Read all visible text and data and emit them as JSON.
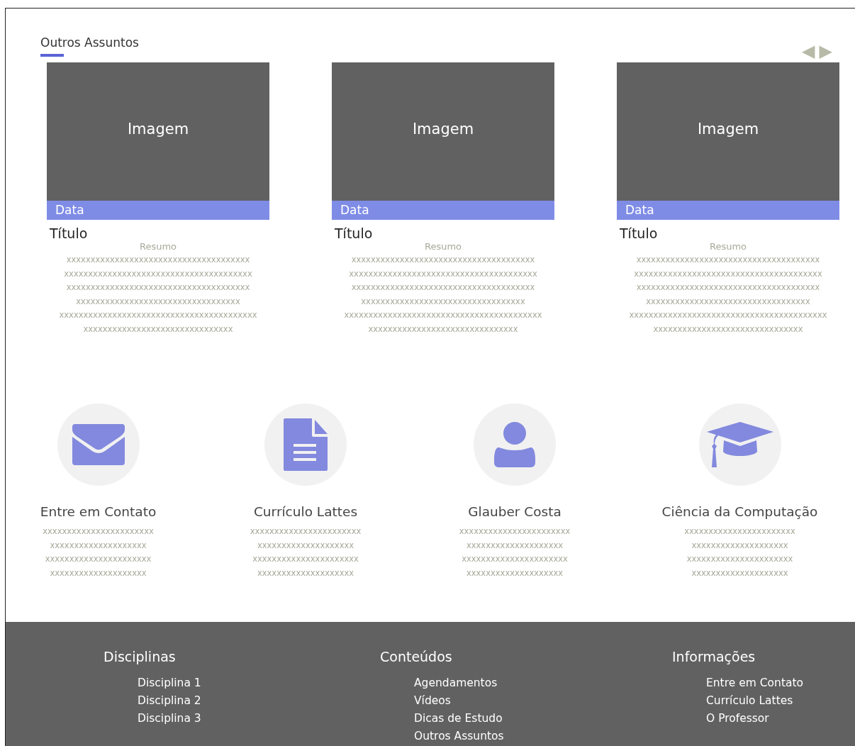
{
  "section": {
    "title": "Outros Assuntos"
  },
  "nav": {
    "prev": "◀",
    "next": "▶"
  },
  "cards": [
    {
      "image_label": "Imagem",
      "date": "Data",
      "title": "Título",
      "summary_label": "Resumo",
      "lines": [
        "xxxxxxxxxxxxxxxxxxxxxxxxxxxxxxxxxxxxxx",
        "xxxxxxxxxxxxxxxxxxxxxxxxxxxxxxxxxxxxxxx",
        "xxxxxxxxxxxxxxxxxxxxxxxxxxxxxxxxxxxxxx",
        "xxxxxxxxxxxxxxxxxxxxxxxxxxxxxxxxxx",
        "xxxxxxxxxxxxxxxxxxxxxxxxxxxxxxxxxxxxxxxxx",
        "xxxxxxxxxxxxxxxxxxxxxxxxxxxxxxx"
      ]
    },
    {
      "image_label": "Imagem",
      "date": "Data",
      "title": "Título",
      "summary_label": "Resumo",
      "lines": [
        "xxxxxxxxxxxxxxxxxxxxxxxxxxxxxxxxxxxxxx",
        "xxxxxxxxxxxxxxxxxxxxxxxxxxxxxxxxxxxxxxx",
        "xxxxxxxxxxxxxxxxxxxxxxxxxxxxxxxxxxxxxx",
        "xxxxxxxxxxxxxxxxxxxxxxxxxxxxxxxxxx",
        "xxxxxxxxxxxxxxxxxxxxxxxxxxxxxxxxxxxxxxxxx",
        "xxxxxxxxxxxxxxxxxxxxxxxxxxxxxxx"
      ]
    },
    {
      "image_label": "Imagem",
      "date": "Data",
      "title": "Título",
      "summary_label": "Resumo",
      "lines": [
        "xxxxxxxxxxxxxxxxxxxxxxxxxxxxxxxxxxxxxx",
        "xxxxxxxxxxxxxxxxxxxxxxxxxxxxxxxxxxxxxxx",
        "xxxxxxxxxxxxxxxxxxxxxxxxxxxxxxxxxxxxxx",
        "xxxxxxxxxxxxxxxxxxxxxxxxxxxxxxxxxx",
        "xxxxxxxxxxxxxxxxxxxxxxxxxxxxxxxxxxxxxxxxx",
        "xxxxxxxxxxxxxxxxxxxxxxxxxxxxxxx"
      ]
    }
  ],
  "features": [
    {
      "kind": "mail",
      "title": "Entre em Contato",
      "lines": [
        "xxxxxxxxxxxxxxxxxxxxxxx",
        "xxxxxxxxxxxxxxxxxxxx",
        "xxxxxxxxxxxxxxxxxxxxxx",
        "xxxxxxxxxxxxxxxxxxxx"
      ]
    },
    {
      "kind": "document",
      "title": "Currículo Lattes",
      "lines": [
        "xxxxxxxxxxxxxxxxxxxxxxx",
        "xxxxxxxxxxxxxxxxxxxx",
        "xxxxxxxxxxxxxxxxxxxxxx",
        "xxxxxxxxxxxxxxxxxxxx"
      ]
    },
    {
      "kind": "person",
      "title": "Glauber Costa",
      "lines": [
        "xxxxxxxxxxxxxxxxxxxxxxx",
        "xxxxxxxxxxxxxxxxxxxx",
        "xxxxxxxxxxxxxxxxxxxxxx",
        "xxxxxxxxxxxxxxxxxxxx"
      ]
    },
    {
      "kind": "graduation",
      "title": "Ciência da Computação",
      "lines": [
        "xxxxxxxxxxxxxxxxxxxxxxx",
        "xxxxxxxxxxxxxxxxxxxx",
        "xxxxxxxxxxxxxxxxxxxxxx",
        "xxxxxxxxxxxxxxxxxxxx"
      ]
    }
  ],
  "footer": {
    "columns": [
      {
        "title": "Disciplinas",
        "links": [
          "Disciplina 1",
          "Disciplina 2",
          "Disciplina 3"
        ]
      },
      {
        "title": "Conteúdos",
        "links": [
          "Agendamentos",
          "Vídeos",
          "Dicas de Estudo",
          "Outros Assuntos"
        ]
      },
      {
        "title": "Informações",
        "links": [
          "Entre em Contato",
          "Currículo Lattes",
          "O Professor"
        ]
      }
    ]
  }
}
